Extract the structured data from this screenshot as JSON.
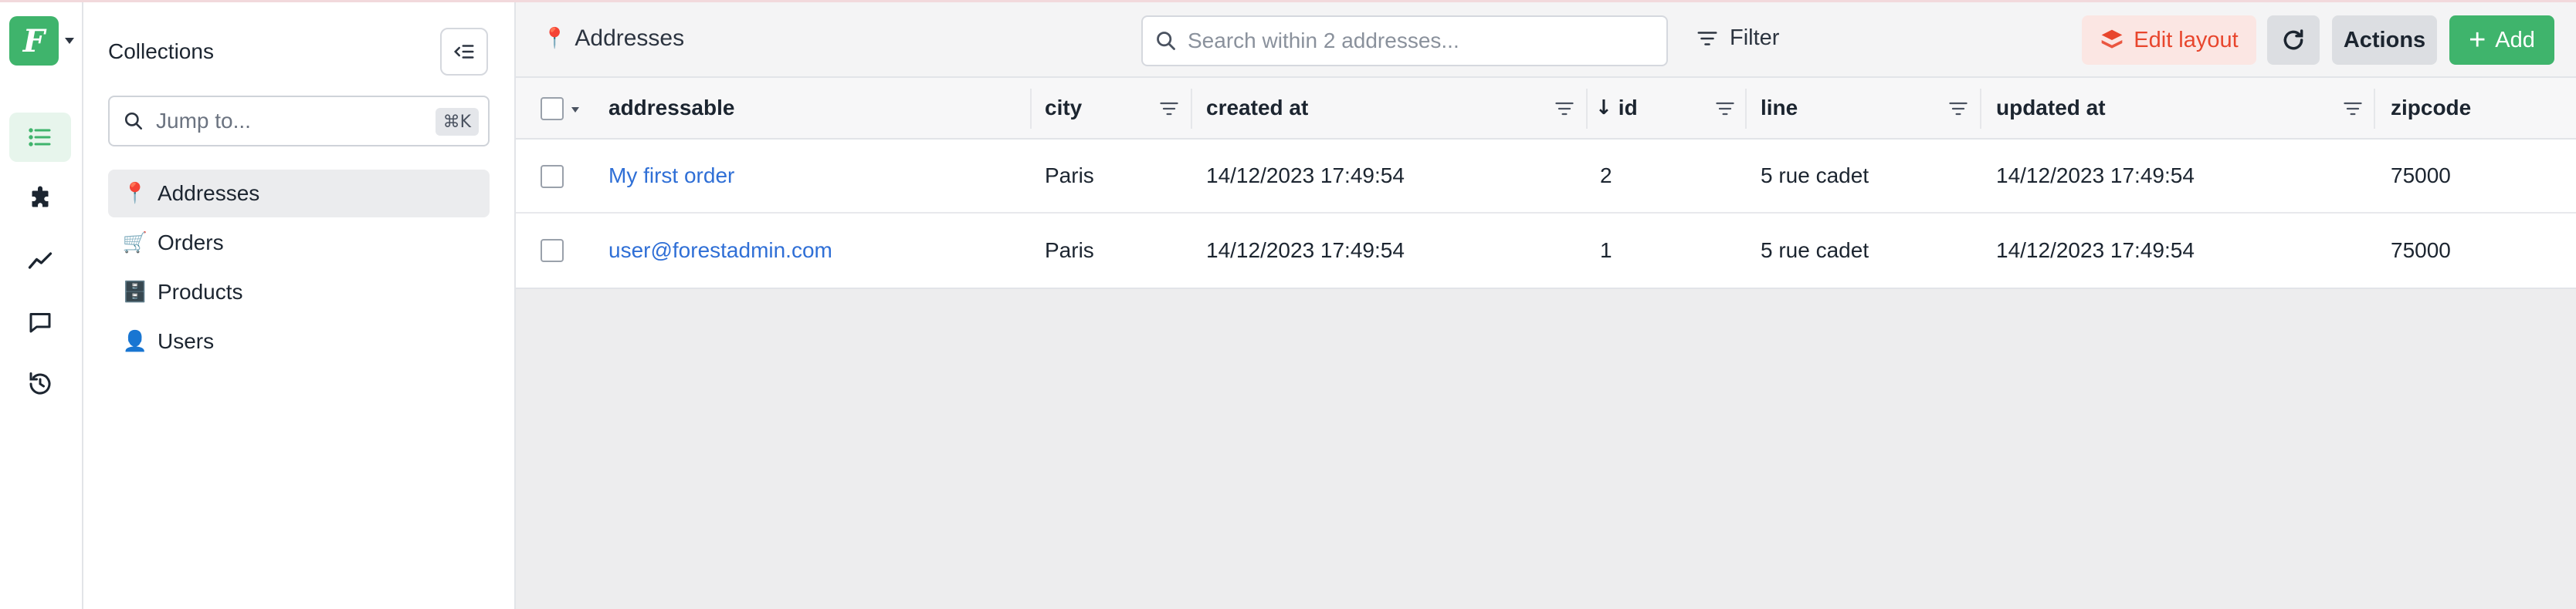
{
  "app": {
    "logo_letter": "F",
    "accent_color": "#3fb46c"
  },
  "rail": {
    "items": [
      {
        "icon": "list-icon",
        "active": true
      },
      {
        "icon": "puzzle-icon",
        "active": false
      },
      {
        "icon": "chart-line-icon",
        "active": false
      },
      {
        "icon": "chat-icon",
        "active": false
      },
      {
        "icon": "history-icon",
        "active": false
      }
    ]
  },
  "sidebar": {
    "title": "Collections",
    "jump_placeholder": "Jump to...",
    "shortcut": "⌘K",
    "items": [
      {
        "emoji": "📍",
        "label": "Addresses",
        "active": true
      },
      {
        "emoji": "🛒",
        "label": "Orders",
        "active": false
      },
      {
        "emoji": "🗄️",
        "label": "Products",
        "active": false
      },
      {
        "emoji": "👤",
        "label": "Users",
        "active": false
      }
    ]
  },
  "toolbar": {
    "breadcrumb_emoji": "📍",
    "breadcrumb": "Addresses",
    "search_placeholder": "Search within 2 addresses...",
    "filter_label": "Filter",
    "edit_layout_label": "Edit layout",
    "actions_label": "Actions",
    "add_label": "Add"
  },
  "table": {
    "columns": [
      {
        "key": "addressable",
        "label": "addressable"
      },
      {
        "key": "city",
        "label": "city"
      },
      {
        "key": "created_at",
        "label": "created at"
      },
      {
        "key": "id",
        "label": "id",
        "sort": "desc"
      },
      {
        "key": "line",
        "label": "line"
      },
      {
        "key": "updated_at",
        "label": "updated at"
      },
      {
        "key": "zipcode",
        "label": "zipcode"
      }
    ],
    "rows": [
      {
        "addressable": "My first order",
        "city": "Paris",
        "created_at": "14/12/2023 17:49:54",
        "id": "2",
        "line": "5 rue cadet",
        "updated_at": "14/12/2023 17:49:54",
        "zipcode": "75000"
      },
      {
        "addressable": "user@forestadmin.com",
        "city": "Paris",
        "created_at": "14/12/2023 17:49:54",
        "id": "1",
        "line": "5 rue cadet",
        "updated_at": "14/12/2023 17:49:54",
        "zipcode": "75000"
      }
    ]
  }
}
